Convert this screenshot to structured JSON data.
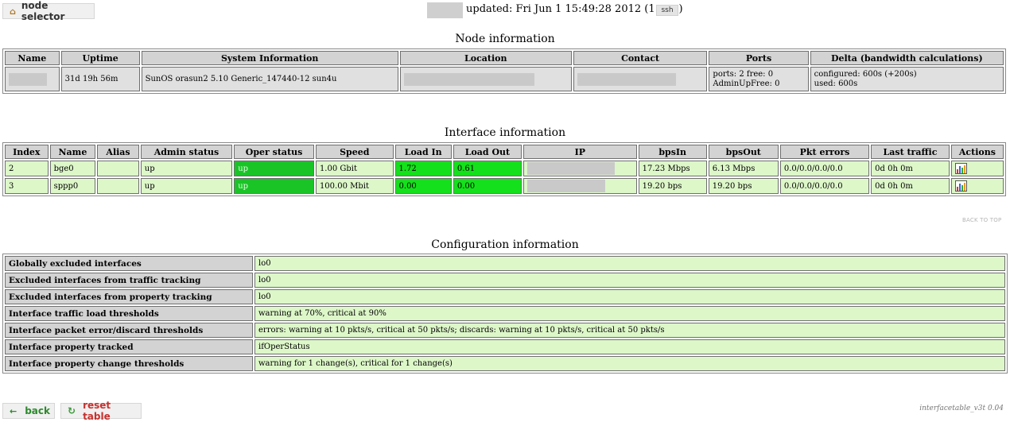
{
  "top": {
    "node_selector_label": "node selector",
    "updated_text": "updated: Fri Jun 1 15:49:28 2012 (1 sec.)",
    "ssh_label": "ssh"
  },
  "node_info": {
    "title": "Node information",
    "headers": [
      "Name",
      "Uptime",
      "System Information",
      "Location",
      "Contact",
      "Ports",
      "Delta (bandwidth calculations)"
    ],
    "row": {
      "uptime": "31d 19h 56m",
      "system_information": "SunOS orasun2 5.10 Generic_147440-12 sun4u",
      "ports_line1": "ports: 2 free: 0",
      "ports_line2": "AdminUpFree: 0",
      "delta_line1": "configured: 600s (+200s)",
      "delta_line2": "used: 600s"
    }
  },
  "interface_info": {
    "title": "Interface information",
    "headers": [
      "Index",
      "Name",
      "Alias",
      "Admin status",
      "Oper status",
      "Speed",
      "Load In",
      "Load Out",
      "IP",
      "bpsIn",
      "bpsOut",
      "Pkt errors",
      "Last traffic",
      "Actions"
    ],
    "rows": [
      {
        "index": "2",
        "name": "bge0",
        "alias": "",
        "admin": "up",
        "oper": "up",
        "speed": "1.00 Gbit",
        "load_in": "1.72",
        "load_out": "0.61",
        "bps_in": "17.23 Mbps",
        "bps_out": "6.13 Mbps",
        "pkt_errors": "0.0/0.0/0.0/0.0",
        "last_traffic": "0d 0h 0m"
      },
      {
        "index": "3",
        "name": "sppp0",
        "alias": "",
        "admin": "up",
        "oper": "up",
        "speed": "100.00 Mbit",
        "load_in": "0.00",
        "load_out": "0.00",
        "bps_in": "19.20 bps",
        "bps_out": "19.20 bps",
        "pkt_errors": "0.0/0.0/0.0/0.0",
        "last_traffic": "0d 0h 0m"
      }
    ],
    "back_to_top": "BACK TO TOP"
  },
  "config_info": {
    "title": "Configuration information",
    "rows": [
      {
        "label": "Globally excluded interfaces",
        "value": "lo0"
      },
      {
        "label": "Excluded interfaces from traffic tracking",
        "value": "lo0"
      },
      {
        "label": "Excluded interfaces from property tracking",
        "value": "lo0"
      },
      {
        "label": "Interface traffic load thresholds",
        "value": "warning at 70%, critical at 90%"
      },
      {
        "label": "Interface packet error/discard thresholds",
        "value": "errors: warning at 10 pkts/s, critical at 50 pkts/s; discards: warning at 10 pkts/s, critical at 50 pkts/s"
      },
      {
        "label": "Interface property tracked",
        "value": "ifOperStatus"
      },
      {
        "label": "Interface property change thresholds",
        "value": "warning for 1 change(s), critical for 1 change(s)"
      }
    ]
  },
  "footer": {
    "back_label": "back",
    "reset_label": "reset table",
    "version": "interfacetable_v3t 0.04"
  },
  "colors": {
    "row_background": "#ddf7c9",
    "header_background": "#d3d3d3",
    "oper_up": "#1ac427",
    "load_green": "#15e01c"
  }
}
